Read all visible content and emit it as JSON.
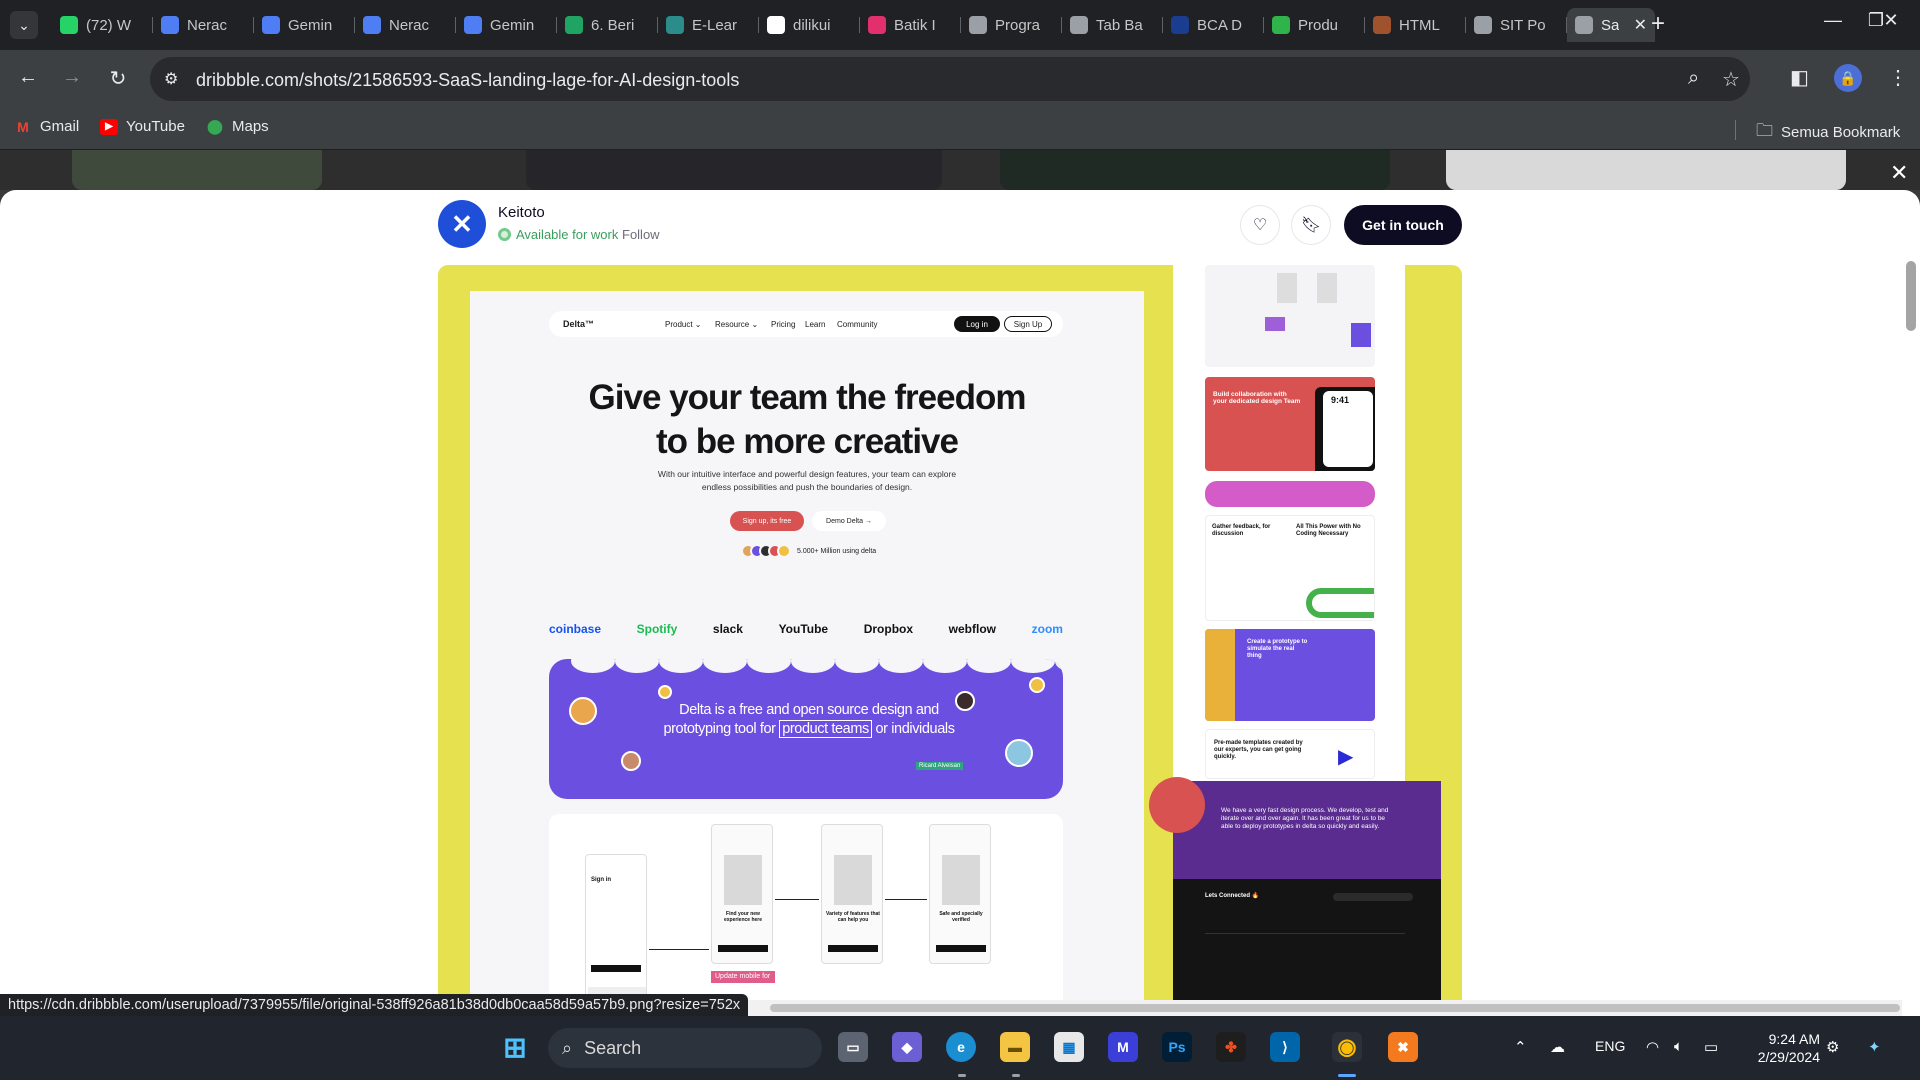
{
  "browser": {
    "tabs": [
      {
        "label": "(72) W",
        "badge": "72",
        "color": "#25d366"
      },
      {
        "label": "Nerac",
        "color": "#4f7df3"
      },
      {
        "label": "Gemin",
        "color": "#4f7df3"
      },
      {
        "label": "Nerac",
        "color": "#4f7df3"
      },
      {
        "label": "Gemin",
        "color": "#4f7df3"
      },
      {
        "label": "6. Beri",
        "color": "#1fa463"
      },
      {
        "label": "E-Lear",
        "color": "#2b8c8c"
      },
      {
        "label": "dilikui",
        "color": "#ffffff"
      },
      {
        "label": "Batik I",
        "color": "#e1306c"
      },
      {
        "label": "Progra",
        "color": "#9aa0a6"
      },
      {
        "label": "Tab Ba",
        "color": "#9aa0a6"
      },
      {
        "label": "BCA D",
        "color": "#1a3d8f"
      },
      {
        "label": "Produ",
        "color": "#2fb34a"
      },
      {
        "label": "HTML",
        "color": "#a0522d"
      },
      {
        "label": "SIT Po",
        "color": "#9aa0a6"
      },
      {
        "label": "Sa",
        "color": "#9aa0a6",
        "active": true
      }
    ],
    "url": "dribbble.com/shots/21586593-SaaS-landing-lage-for-AI-design-tools",
    "bookmarks": [
      {
        "label": "Gmail",
        "color": "#ea4335"
      },
      {
        "label": "YouTube",
        "color": "#ff0000"
      },
      {
        "label": "Maps",
        "color": "#34a853"
      }
    ],
    "all_bookmarks": "Semua Bookmark"
  },
  "shot": {
    "author": "Keitoto",
    "availability": "Available for work",
    "follow": "Follow",
    "cta": "Get in touch"
  },
  "mock": {
    "nav": {
      "logo": "Delta™",
      "links": [
        "Product ⌄",
        "Resource ⌄",
        "Pricing",
        "Learn",
        "Community"
      ],
      "login": "Log in",
      "signup": "Sign Up"
    },
    "hero_line1": "Give your team the freedom",
    "hero_line2": "to be more creative",
    "subtitle": "With our intuitive interface and powerful design features, your team can explore endless possibilities and push the boundaries of design.",
    "cta_primary": "Sign up, its free",
    "cta_secondary": "Demo Delta →",
    "users": "5.000+ Million using delta",
    "brands": [
      {
        "name": "coinbase",
        "color": "#1652f0"
      },
      {
        "name": "Spotify",
        "color": "#1db954"
      },
      {
        "name": "slack",
        "color": "#111111"
      },
      {
        "name": "YouTube",
        "color": "#111111"
      },
      {
        "name": "Dropbox",
        "color": "#111111"
      },
      {
        "name": "webflow",
        "color": "#111111"
      },
      {
        "name": "zoom",
        "color": "#2d8cff"
      }
    ],
    "promo_pre": "Delta is a free and open source design and prototyping tool for",
    "promo_highlight": "product teams",
    "promo_post": "or individuals",
    "cursor_tag": "Ricard Alveisan",
    "flow_screens": [
      "Find your new experience here",
      "Variety of features that can help you",
      "Safe and specially verified"
    ],
    "sign_in": "Sign in",
    "mobile_tag": "Update mobile for",
    "tiles": {
      "collab_title": "Build collaboration with your dedicated design Team",
      "time": "9:41",
      "feedback_title": "Gather feedback, for discussion",
      "power_title": "All This Power with No Coding Necessary",
      "prototype_title": "Create a prototype to simulate the real thing",
      "templates_title": "Pre-made templates created by our experts, you can get going quickly.",
      "quote": "We have a very fast design process. We develop, test and iterate over and over again. It has been great for us to be able to deploy prototypes in delta so quickly and easily.",
      "footer_title": "Lets Connected 🔥"
    }
  },
  "status_url": "https://cdn.dribbble.com/userupload/7379955/file/original-538ff926a81b38d0db0caa58d59a57b9.png?resize=752x",
  "taskbar": {
    "search": "Search",
    "lang": "ENG",
    "time": "9:24 AM",
    "date": "2/29/2024"
  }
}
